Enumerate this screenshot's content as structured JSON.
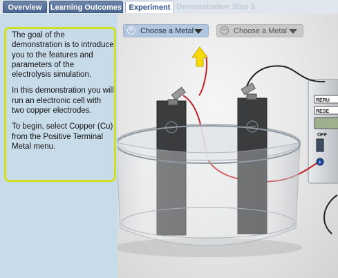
{
  "tabs": [
    {
      "label": "Overview",
      "state": "normal"
    },
    {
      "label": "Learning Outcomes",
      "state": "normal"
    },
    {
      "label": "Experiment",
      "state": "active"
    },
    {
      "label": "Demonstration Step 1",
      "state": "disabled"
    }
  ],
  "panel": {
    "p1": "The goal of the demonstration is to introduce you to the features and parameters of the electrolysis simulation.",
    "p2": "In this demonstration you will run an electronic cell with two copper electrodes.",
    "p3": "To begin, select Copper (Cu) from the Positive Terminal Metal menu."
  },
  "controls": {
    "positive_metal_label": "Choose a Metal",
    "negative_metal_label": "Choose a Metal"
  },
  "meter": {
    "button1": "RERU",
    "button2": "RESE",
    "switch_label": "OFF"
  },
  "colors": {
    "highlight": "#d2e024",
    "pointer_arrow": "#f5d90a",
    "tab_active_text": "#2d4f8a"
  }
}
